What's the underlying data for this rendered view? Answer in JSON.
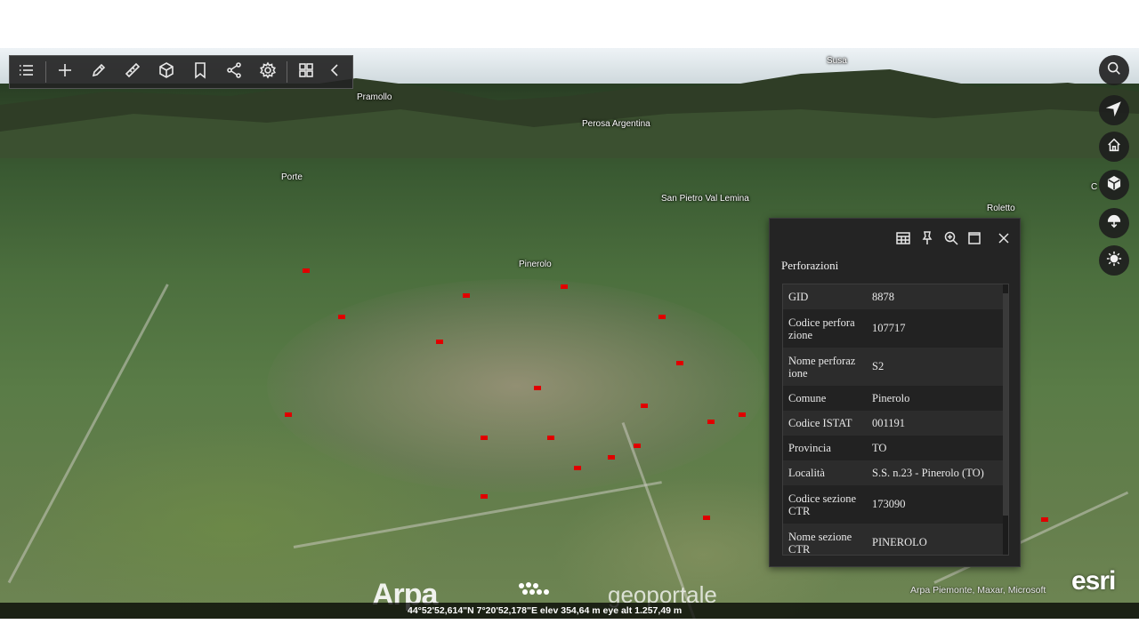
{
  "toolbar": {
    "icons": [
      "list-icon",
      "plus-icon",
      "pencil-icon",
      "ruler-icon",
      "cube-icon",
      "bookmark-icon",
      "share-icon",
      "gear-icon",
      "grid-icon",
      "chevron-left-icon"
    ]
  },
  "map": {
    "places": {
      "susa": "Susa",
      "pramollo": "Pramollo",
      "perosa": "Perosa Argentina",
      "porte": "Porte",
      "san_pietro": "San Pietro Val Lemina",
      "roletto": "Roletto",
      "pinerolo": "Pinerolo",
      "cut_label": "C"
    }
  },
  "rail": {
    "icons": [
      "search-icon",
      "navigate-icon",
      "home-icon",
      "cube-icon",
      "daylight-icon",
      "sun-icon"
    ]
  },
  "popup": {
    "title": "Perforazioni",
    "rows": [
      {
        "key": "GID",
        "value": "8878"
      },
      {
        "key": "Codice perfora zione",
        "value": "107717"
      },
      {
        "key": "Nome perforaz ione",
        "value": "S2"
      },
      {
        "key": "Comune",
        "value": "Pinerolo"
      },
      {
        "key": "Codice ISTAT",
        "value": "001191"
      },
      {
        "key": "Provincia",
        "value": "TO"
      },
      {
        "key": "Località",
        "value": "S.S. n.23 - Pinerolo (TO)"
      },
      {
        "key": "Codice sezione CTR",
        "value": "173090"
      },
      {
        "key": "Nome sezione CTR",
        "value": "PINEROLO"
      }
    ]
  },
  "status": {
    "coords": "44°52'52,614\"N 7°20'52,178\"E  elev 354,64 m   eye alt 1.257,49 m",
    "attribution": "Arpa Piemonte, Maxar, Microsoft",
    "esri": "esri",
    "arpa": "Arpa",
    "geoportale": "geoportale"
  },
  "colors": {
    "marker": "#e00000",
    "panel": "#242424"
  }
}
